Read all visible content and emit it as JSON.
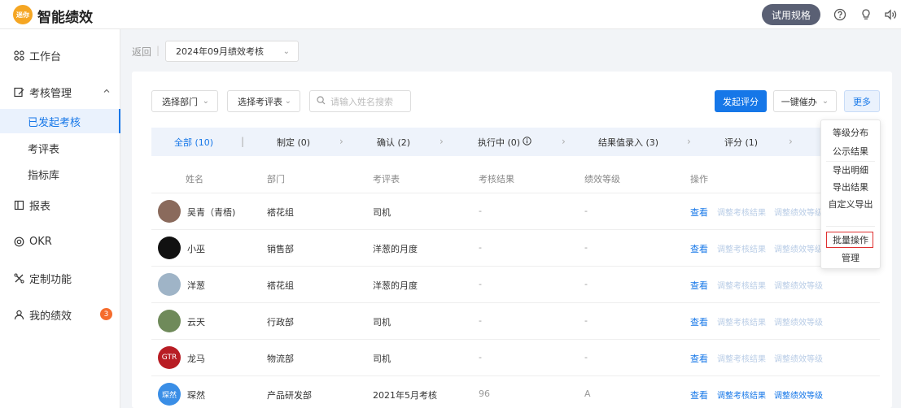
{
  "app": {
    "title": "智能绩效",
    "logo_text": "迷你"
  },
  "header": {
    "trial_label": "试用规格",
    "icons": [
      "help-icon",
      "lightbulb-icon",
      "sound-icon"
    ]
  },
  "sidebar": {
    "items": [
      {
        "label": "工作台",
        "icon": "grid-icon"
      },
      {
        "label": "考核管理",
        "icon": "edit-icon"
      },
      {
        "label": "报表",
        "icon": "report-icon"
      },
      {
        "label": "OKR",
        "icon": "target-icon"
      },
      {
        "label": "定制功能",
        "icon": "tools-icon"
      },
      {
        "label": "我的绩效",
        "icon": "user-icon",
        "badge": "3"
      }
    ],
    "sub_items": [
      {
        "label": "已发起考核",
        "active": true
      },
      {
        "label": "考评表"
      },
      {
        "label": "指标库"
      }
    ]
  },
  "topbar": {
    "back_label": "返回",
    "period": "2024年09月绩效考核"
  },
  "filters": {
    "dept_label": "选择部门",
    "form_label": "选择考评表",
    "search_placeholder": "请输入姓名搜索"
  },
  "actions": {
    "start_label": "发起评分",
    "urge_label": "一键催办",
    "more_label": "更多"
  },
  "steps": [
    {
      "label": "全部 (10)",
      "active": true
    },
    {
      "label": "制定 (0)"
    },
    {
      "label": "确认 (2)"
    },
    {
      "label": "执行中 (0)"
    },
    {
      "label": "结果值录入 (3)"
    },
    {
      "label": "评分 (1)"
    }
  ],
  "table": {
    "headers": [
      "姓名",
      "部门",
      "考评表",
      "考核结果",
      "绩效等级",
      "操作"
    ],
    "rows": [
      {
        "name": "吴青（青梧)",
        "dept": "褡花组",
        "form": "司机",
        "result": "-",
        "level": "-",
        "view": "查看",
        "adjust_result": "调整考核结果",
        "adjust_level": "调整绩效等级",
        "avatar_color": "#8a6a5c",
        "avatar_text": ""
      },
      {
        "name": "小巫",
        "dept": "销售部",
        "form": "洋葱的月度",
        "result": "-",
        "level": "-",
        "view": "查看",
        "adjust_result": "调整考核结果",
        "adjust_level": "调整绩效等级",
        "avatar_color": "#111111",
        "avatar_text": ""
      },
      {
        "name": "洋葱",
        "dept": "褡花组",
        "form": "洋葱的月度",
        "result": "-",
        "level": "-",
        "view": "查看",
        "adjust_result": "调整考核结果",
        "adjust_level": "调整绩效等级",
        "avatar_color": "#9fb4c7",
        "avatar_text": ""
      },
      {
        "name": "云天",
        "dept": "行政部",
        "form": "司机",
        "result": "-",
        "level": "-",
        "view": "查看",
        "adjust_result": "调整考核结果",
        "adjust_level": "调整绩效等级",
        "avatar_color": "#6f8a5a",
        "avatar_text": ""
      },
      {
        "name": "龙马",
        "dept": "物流部",
        "form": "司机",
        "result": "-",
        "level": "-",
        "view": "查看",
        "adjust_result": "调整考核结果",
        "adjust_level": "调整绩效等级",
        "avatar_color": "#b81d24",
        "avatar_text": "GTR"
      },
      {
        "name": "琛然",
        "dept": "产品研发部",
        "form": "2021年5月考核",
        "result": "96",
        "level": "A",
        "view": "查看",
        "adjust_result": "调整考核结果",
        "adjust_level": "调整绩效等级",
        "avatar_color": "#3a8ee6",
        "avatar_text": "琛然"
      }
    ]
  },
  "more_menu": {
    "items": [
      "等级分布",
      "公示结果",
      "导出明细",
      "导出结果",
      "自定义导出",
      "批量操作",
      "管理"
    ],
    "highlighted": "批量操作"
  }
}
